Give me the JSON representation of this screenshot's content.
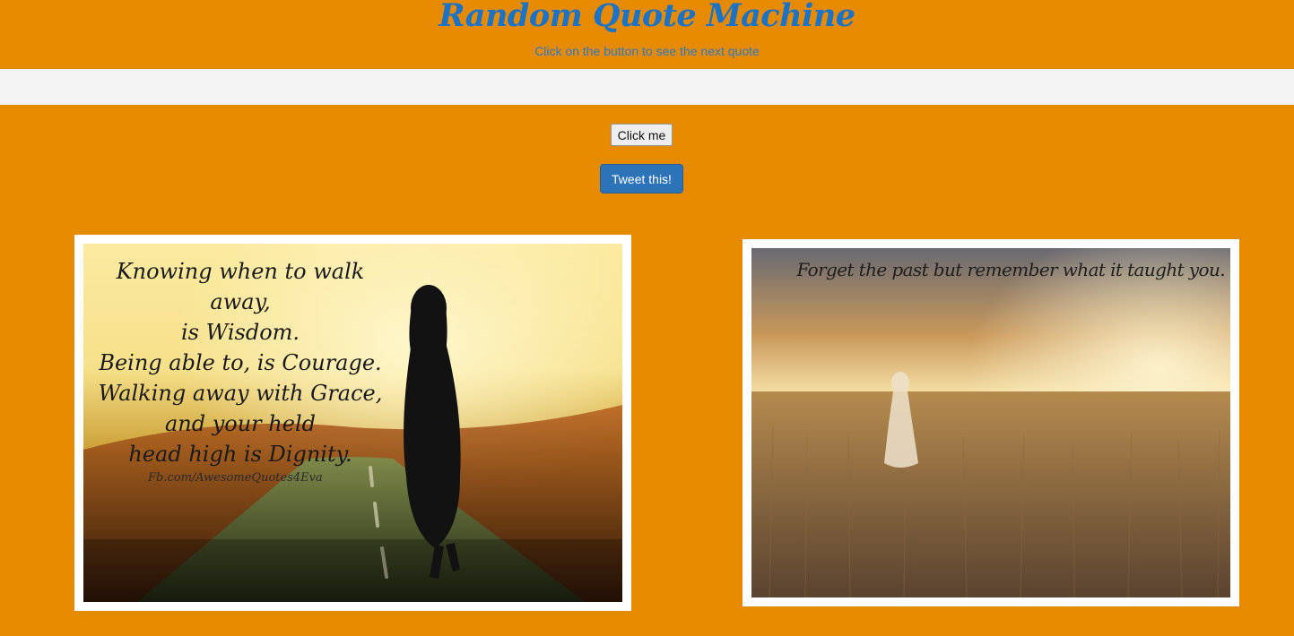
{
  "header": {
    "title": "Random Quote Machine",
    "subtitle": "Click on the button to see the next quote"
  },
  "quote": {
    "text": ""
  },
  "controls": {
    "click_label": "Click me",
    "tweet_label": "Tweet this!"
  },
  "images": [
    {
      "lines": [
        "Knowing when to walk away,",
        "is Wisdom.",
        "Being able to, is Courage.",
        "Walking away with Grace,",
        "and your held",
        "head high is Dignity."
      ],
      "watermark": "Fb.com/AwesomeQuotes4Eva"
    },
    {
      "text": "Forget the past but remember what it taught you."
    }
  ],
  "colors": {
    "background": "#e68a00",
    "title": "#1a73c6",
    "quote_bar": "#f4f4f4",
    "tweet_button": "#2d73b8"
  }
}
